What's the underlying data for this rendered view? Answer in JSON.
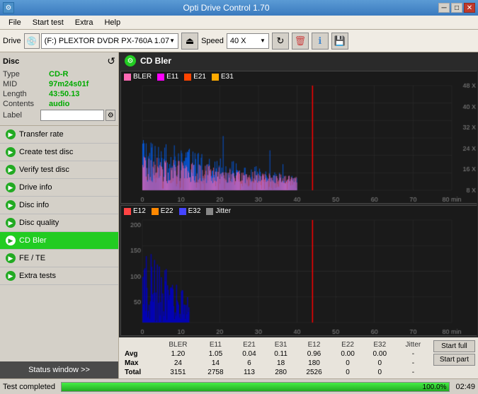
{
  "titleBar": {
    "title": "Opti Drive Control 1.70",
    "icon": "⚙"
  },
  "menuBar": {
    "items": [
      "File",
      "Start test",
      "Extra",
      "Help"
    ]
  },
  "toolbar": {
    "driveLabel": "Drive",
    "driveIcon": "💿",
    "driveValue": "(F:)  PLEXTOR DVDR  PX-760A 1.07",
    "speedLabel": "Speed",
    "speedValue": "40 X"
  },
  "disc": {
    "title": "Disc",
    "type": {
      "label": "Type",
      "value": "CD-R"
    },
    "mid": {
      "label": "MID",
      "value": "97m24s01f"
    },
    "length": {
      "label": "Length",
      "value": "43:50.13"
    },
    "contents": {
      "label": "Contents",
      "value": "audio"
    },
    "labelField": {
      "label": "Label",
      "value": ""
    }
  },
  "navItems": [
    {
      "id": "transfer-rate",
      "label": "Transfer rate",
      "active": false
    },
    {
      "id": "create-test-disc",
      "label": "Create test disc",
      "active": false
    },
    {
      "id": "verify-test-disc",
      "label": "Verify test disc",
      "active": false
    },
    {
      "id": "drive-info",
      "label": "Drive info",
      "active": false
    },
    {
      "id": "disc-info",
      "label": "Disc info",
      "active": false
    },
    {
      "id": "disc-quality",
      "label": "Disc quality",
      "active": false
    },
    {
      "id": "cd-bler",
      "label": "CD Bler",
      "active": true
    },
    {
      "id": "fe-te",
      "label": "FE / TE",
      "active": false
    },
    {
      "id": "extra-tests",
      "label": "Extra tests",
      "active": false
    }
  ],
  "statusWindowBtn": "Status window >>",
  "chart": {
    "title": "CD Bler",
    "icon": "⚙",
    "topChart": {
      "legend": [
        {
          "color": "#ff69b4",
          "label": "BLER"
        },
        {
          "color": "#ff00ff",
          "label": "E11"
        },
        {
          "color": "#ff4400",
          "label": "E21"
        },
        {
          "color": "#ffaa00",
          "label": "E31"
        }
      ],
      "yLabels": [
        "48 X",
        "40 X",
        "32 X",
        "24 X",
        "16 X",
        "8 X"
      ],
      "xLabels": [
        "0",
        "10",
        "20",
        "30",
        "40",
        "50",
        "60",
        "70",
        "80 min"
      ]
    },
    "bottomChart": {
      "legend": [
        {
          "color": "#ff4444",
          "label": "E12"
        },
        {
          "color": "#ff8800",
          "label": "E22"
        },
        {
          "color": "#4444ff",
          "label": "E32"
        },
        {
          "color": "#888888",
          "label": "Jitter"
        }
      ],
      "yLabels": [
        "200",
        "150",
        "100",
        "50"
      ],
      "xLabels": [
        "0",
        "10",
        "20",
        "30",
        "40",
        "50",
        "60",
        "70",
        "80 min"
      ]
    }
  },
  "stats": {
    "columns": [
      "",
      "BLER",
      "E11",
      "E21",
      "E31",
      "E12",
      "E22",
      "E32",
      "Jitter",
      ""
    ],
    "rows": [
      {
        "label": "Avg",
        "bler": "1.20",
        "e11": "1.05",
        "e21": "0.04",
        "e31": "0.11",
        "e12": "0.96",
        "e22": "0.00",
        "e32": "0.00",
        "jitter": "-"
      },
      {
        "label": "Max",
        "bler": "24",
        "e11": "14",
        "e21": "6",
        "e31": "18",
        "e12": "180",
        "e22": "0",
        "e32": "0",
        "jitter": "-"
      },
      {
        "label": "Total",
        "bler": "3151",
        "e11": "2758",
        "e21": "113",
        "e31": "280",
        "e12": "2526",
        "e22": "0",
        "e32": "0",
        "jitter": "-"
      }
    ],
    "buttons": [
      "Start full",
      "Start part"
    ]
  },
  "statusBar": {
    "text": "Test completed",
    "progress": 100.0,
    "progressText": "100.0%",
    "time": "02:49"
  }
}
